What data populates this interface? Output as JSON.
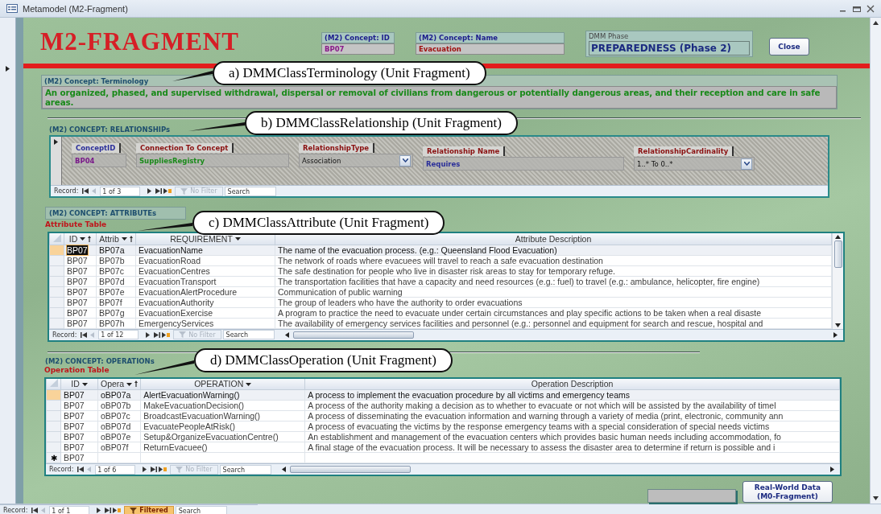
{
  "window": {
    "title": "Metamodel (M2-Fragment)"
  },
  "header": {
    "title": "M2-FRAGMENT",
    "concept_id": {
      "label": "(M2) Concept: ID",
      "value": "BP07"
    },
    "concept_name": {
      "label": "(M2) Concept: Name",
      "value": "Evacuation"
    },
    "dmm_phase": {
      "label": "DMM Phase",
      "value": "PREPAREDNESS (Phase 2)"
    },
    "close_button": "Close"
  },
  "terminology": {
    "label": "(M2) Concept: Terminology",
    "text": "An organized, phased, and supervised withdrawal, dispersal or removal of civilians from dangerous or potentially dangerous areas, and their reception and care in safe areas.",
    "callout": "a) DMMClassTerminology (Unit Fragment)"
  },
  "relationships": {
    "label": "(M2) CONCEPT: RELATIONSHIPs",
    "callout": "b) DMMClassRelationship (Unit Fragment)",
    "fields": [
      {
        "label": "ConceptID",
        "value": "BP04",
        "kind": "text"
      },
      {
        "label": "Connection To Concept",
        "value": "SuppliesRegistry",
        "kind": "text"
      },
      {
        "label": "RelationshipType",
        "value": "Association",
        "kind": "combo"
      },
      {
        "label": "Relationship Name",
        "value": "Requires",
        "kind": "text"
      },
      {
        "label": "RelationshipCardinality",
        "value": "1..* To 0..*",
        "kind": "combo"
      }
    ],
    "navigator": {
      "label": "Record:",
      "position": "1 of 3",
      "filter": "No Filter",
      "filter_active": false,
      "search": "Search"
    }
  },
  "attributes": {
    "label": "(M2) CONCEPT: ATTRIBUTEs",
    "table_title": "Attribute Table",
    "callout": "c) DMMClassAttribute (Unit Fragment)",
    "columns": [
      {
        "label": "ID",
        "dropdown": true,
        "sorted": true
      },
      {
        "label": "Attrib",
        "dropdown": true,
        "sorted": true
      },
      {
        "label": "REQUIREMENT",
        "dropdown": true,
        "sorted": false
      },
      {
        "label": "Attribute Description",
        "dropdown": false,
        "sorted": false
      }
    ],
    "rows": [
      {
        "cells": [
          "BP07",
          "BP07a",
          "EvacuationName",
          "The name of the evacuation process. (e.g.: Queensland Flood Evacuation)"
        ],
        "selected": true,
        "editing": true
      },
      {
        "cells": [
          "BP07",
          "BP07b",
          "EvacuationRoad",
          "The network of roads where evacuees will travel to reach a safe evacuation destination"
        ],
        "selected": false,
        "editing": false
      },
      {
        "cells": [
          "BP07",
          "BP07c",
          "EvacuationCentres",
          "The safe destination for people who live in disaster risk areas to stay for temporary refuge."
        ],
        "selected": false,
        "editing": false
      },
      {
        "cells": [
          "BP07",
          "BP07d",
          "EvacuationTransport",
          "The transportation facilities that have a capacity and need resources (e.g.: fuel) to travel (e.g.: ambulance, helicopter, fire engine)"
        ],
        "selected": false,
        "editing": false
      },
      {
        "cells": [
          "BP07",
          "BP07e",
          "EvacuationAlertProcedure",
          "Communication of public warning"
        ],
        "selected": false,
        "editing": false
      },
      {
        "cells": [
          "BP07",
          "BP07f",
          "EvacuationAuthority",
          "The group of leaders who have the authority to order evacuations"
        ],
        "selected": false,
        "editing": false
      },
      {
        "cells": [
          "BP07",
          "BP07g",
          "EvacuationExercise",
          "A program to practice the need to evacuate under certain circumstances and play specific actions to be taken when a real disaste"
        ],
        "selected": false,
        "editing": false
      },
      {
        "cells": [
          "BP07",
          "BP07h",
          "EmergencyServices",
          "The availability of emergency services facilities and personnel (e.g.: personnel and equipment for search and rescue, hospital and"
        ],
        "selected": false,
        "editing": false
      }
    ],
    "navigator": {
      "label": "Record:",
      "position": "1 of 12",
      "filter": "No Filter",
      "filter_active": false,
      "search": "Search"
    }
  },
  "operations": {
    "label": "(M2) CONCEPT: OPERATIONs",
    "table_title": "Operation Table",
    "callout": "d) DMMClassOperation (Unit Fragment)",
    "columns": [
      {
        "label": "ID",
        "dropdown": true,
        "sorted": false
      },
      {
        "label": "Opera",
        "dropdown": true,
        "sorted": true
      },
      {
        "label": "OPERATION",
        "dropdown": true,
        "sorted": false
      },
      {
        "label": "Operation Description",
        "dropdown": false,
        "sorted": false
      }
    ],
    "rows": [
      {
        "cells": [
          "BP07",
          "oBP07a",
          "AlertEvacuationWarning()",
          "A process to implement the evacuation procedure by all victims and emergency teams"
        ],
        "selected": true,
        "editing": false
      },
      {
        "cells": [
          "BP07",
          "oBP07b",
          "MakeEvacuationDecision()",
          "A process of the authority making a decision as to whether to evacuate or not which will be assisted by the availability of timel"
        ],
        "selected": false,
        "editing": false
      },
      {
        "cells": [
          "BP07",
          "oBP07c",
          "BroadcastEvacuationWarning()",
          "A process of disseminating the evacuation information and warning through a variety of media (print, electronic, community ann"
        ],
        "selected": false,
        "editing": false
      },
      {
        "cells": [
          "BP07",
          "oBP07d",
          "EvacuatePeopleAtRisk()",
          "A process of evacuating the victims by the response emergency teams with a special consideration of special needs victims"
        ],
        "selected": false,
        "editing": false
      },
      {
        "cells": [
          "BP07",
          "oBP07e",
          "Setup&OrganizeEvacuationCentre()",
          "An establishment and management of the evacuation centers which provides basic human needs including accommodation, fo"
        ],
        "selected": false,
        "editing": false
      },
      {
        "cells": [
          "BP07",
          "oBP07f",
          "ReturnEvacuee()",
          "A final stage of the evacuation process. It will be necessary to assess the disaster area to determine if return is possible and i"
        ],
        "selected": false,
        "editing": false
      },
      {
        "kind": "new",
        "selector": "✱",
        "cells": [
          "BP07"
        ],
        "selected": false,
        "editing": false
      }
    ],
    "navigator": {
      "label": "Record:",
      "position": "1 of 6",
      "filter": "No Filter",
      "filter_active": false,
      "search": "Search"
    }
  },
  "real_world_button": "Real-World Data (M0-Fragment)",
  "status_bar": {
    "label": "Record:",
    "position": "1 of 1",
    "filter": "Filtered",
    "filter_active": true,
    "search": "Search"
  }
}
